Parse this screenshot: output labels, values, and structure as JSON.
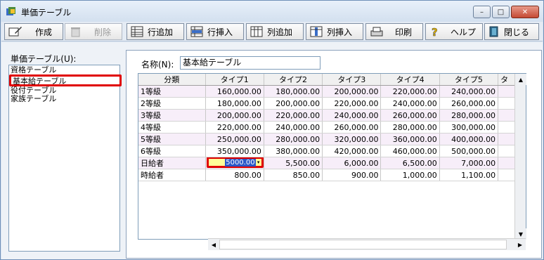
{
  "window": {
    "title": "単価テーブル",
    "controls": {
      "minimize": "–",
      "maximize": "□",
      "close": "✕"
    }
  },
  "toolbar": {
    "create": "作成",
    "delete": "削除",
    "add_row": "行追加",
    "insert_row": "行挿入",
    "add_col": "列追加",
    "insert_col": "列挿入",
    "print": "印刷",
    "help": "ヘルプ",
    "close": "閉じる"
  },
  "left": {
    "label": "単価テーブル(U):",
    "items": [
      "資格テーブル",
      "基本給テーブル",
      "役付テーブル",
      "家族テーブル"
    ],
    "selected_index": 1
  },
  "form": {
    "name_label": "名称(N):",
    "name_value": "基本給テーブル"
  },
  "grid": {
    "headers": [
      "分類",
      "タイプ1",
      "タイプ2",
      "タイプ3",
      "タイプ4",
      "タイプ5",
      "タ"
    ],
    "rows": [
      [
        "1等級",
        "160,000.00",
        "180,000.00",
        "200,000.00",
        "220,000.00",
        "240,000.00"
      ],
      [
        "2等級",
        "180,000.00",
        "200,000.00",
        "220,000.00",
        "240,000.00",
        "260,000.00"
      ],
      [
        "3等級",
        "200,000.00",
        "220,000.00",
        "240,000.00",
        "260,000.00",
        "280,000.00"
      ],
      [
        "4等級",
        "220,000.00",
        "240,000.00",
        "260,000.00",
        "280,000.00",
        "300,000.00"
      ],
      [
        "5等級",
        "250,000.00",
        "280,000.00",
        "320,000.00",
        "360,000.00",
        "400,000.00"
      ],
      [
        "6等級",
        "350,000.00",
        "380,000.00",
        "420,000.00",
        "460,000.00",
        "500,000.00"
      ],
      [
        "日給者",
        "5000.00",
        "5,500.00",
        "6,000.00",
        "6,500.00",
        "7,000.00"
      ],
      [
        "時給者",
        "800.00",
        "850.00",
        "900.00",
        "1,000.00",
        "1,100.00"
      ]
    ],
    "editing_value": "5000.00"
  }
}
